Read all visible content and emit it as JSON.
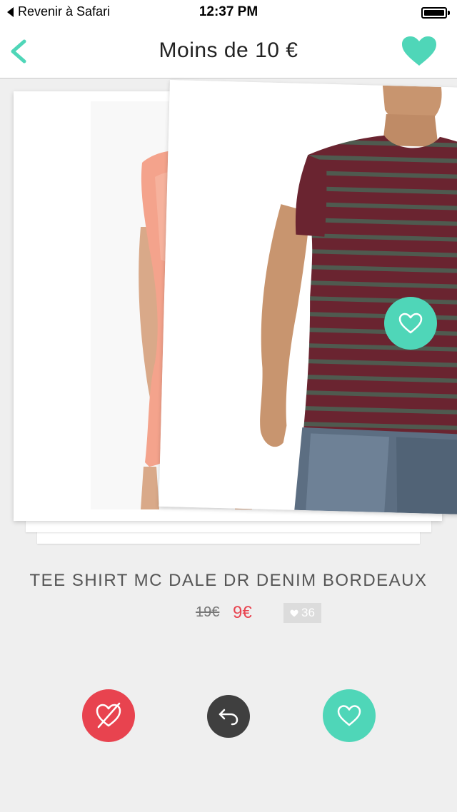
{
  "status_bar": {
    "back_label": "Revenir à Safari",
    "time": "12:37 PM"
  },
  "nav": {
    "title": "Moins de 10 €",
    "back_icon": "chevron-left-icon",
    "favorites_icon": "heart-icon"
  },
  "product": {
    "title": "TEE SHIRT MC DALE DR DENIM BORDEAUX",
    "old_price": "19€",
    "new_price": "9€",
    "likes": "36"
  },
  "actions": {
    "dislike_icon": "heart-crossed-icon",
    "undo_icon": "undo-icon",
    "like_icon": "heart-outline-icon"
  },
  "colors": {
    "accent": "#4fd6b8",
    "danger": "#e8434f",
    "dark": "#3f3f3f",
    "background": "#efefef"
  }
}
